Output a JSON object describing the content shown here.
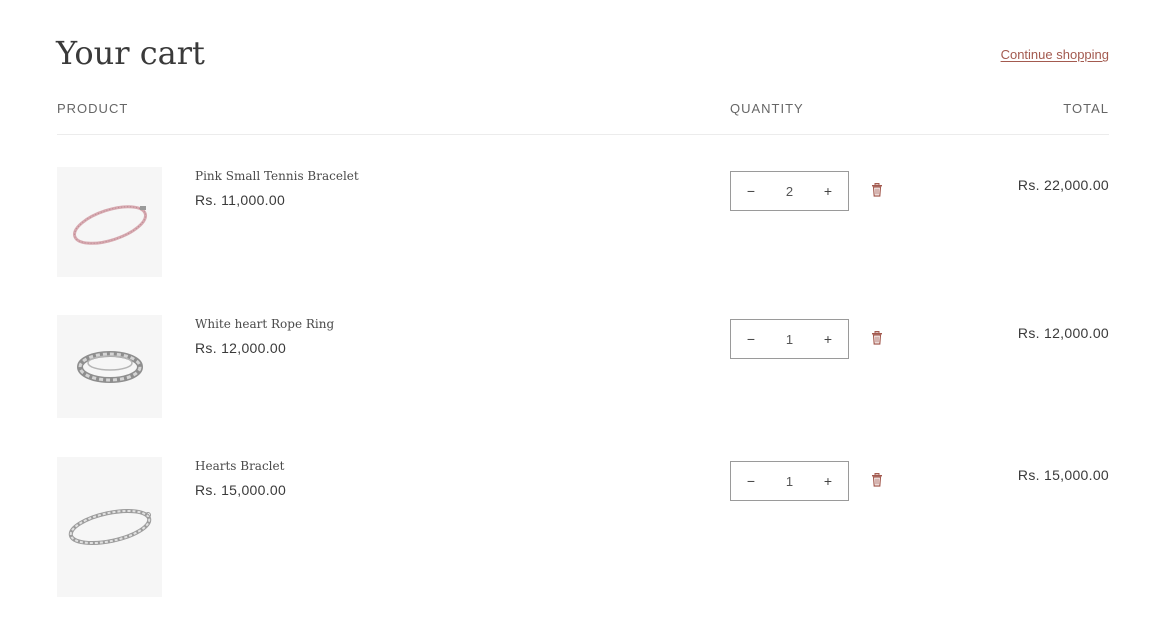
{
  "header": {
    "title": "Your cart",
    "continue_label": "Continue shopping"
  },
  "columns": {
    "product": "PRODUCT",
    "quantity": "QUANTITY",
    "total": "TOTAL"
  },
  "items": [
    {
      "name": "Pink Small Tennis Bracelet",
      "price": "Rs. 11,000.00",
      "quantity": "2",
      "total": "Rs. 22,000.00",
      "image": "pink-tennis-bracelet-image"
    },
    {
      "name": "White heart Rope Ring",
      "price": "Rs. 12,000.00",
      "quantity": "1",
      "total": "Rs. 12,000.00",
      "image": "rope-ring-image"
    },
    {
      "name": "Hearts Braclet",
      "price": "Rs. 15,000.00",
      "quantity": "1",
      "total": "Rs. 15,000.00",
      "image": "hearts-bracelet-image"
    }
  ],
  "controls": {
    "minus": "−",
    "plus": "+"
  },
  "colors": {
    "accent": "#a35a4f",
    "thumb_bg": "#f6f6f6"
  }
}
